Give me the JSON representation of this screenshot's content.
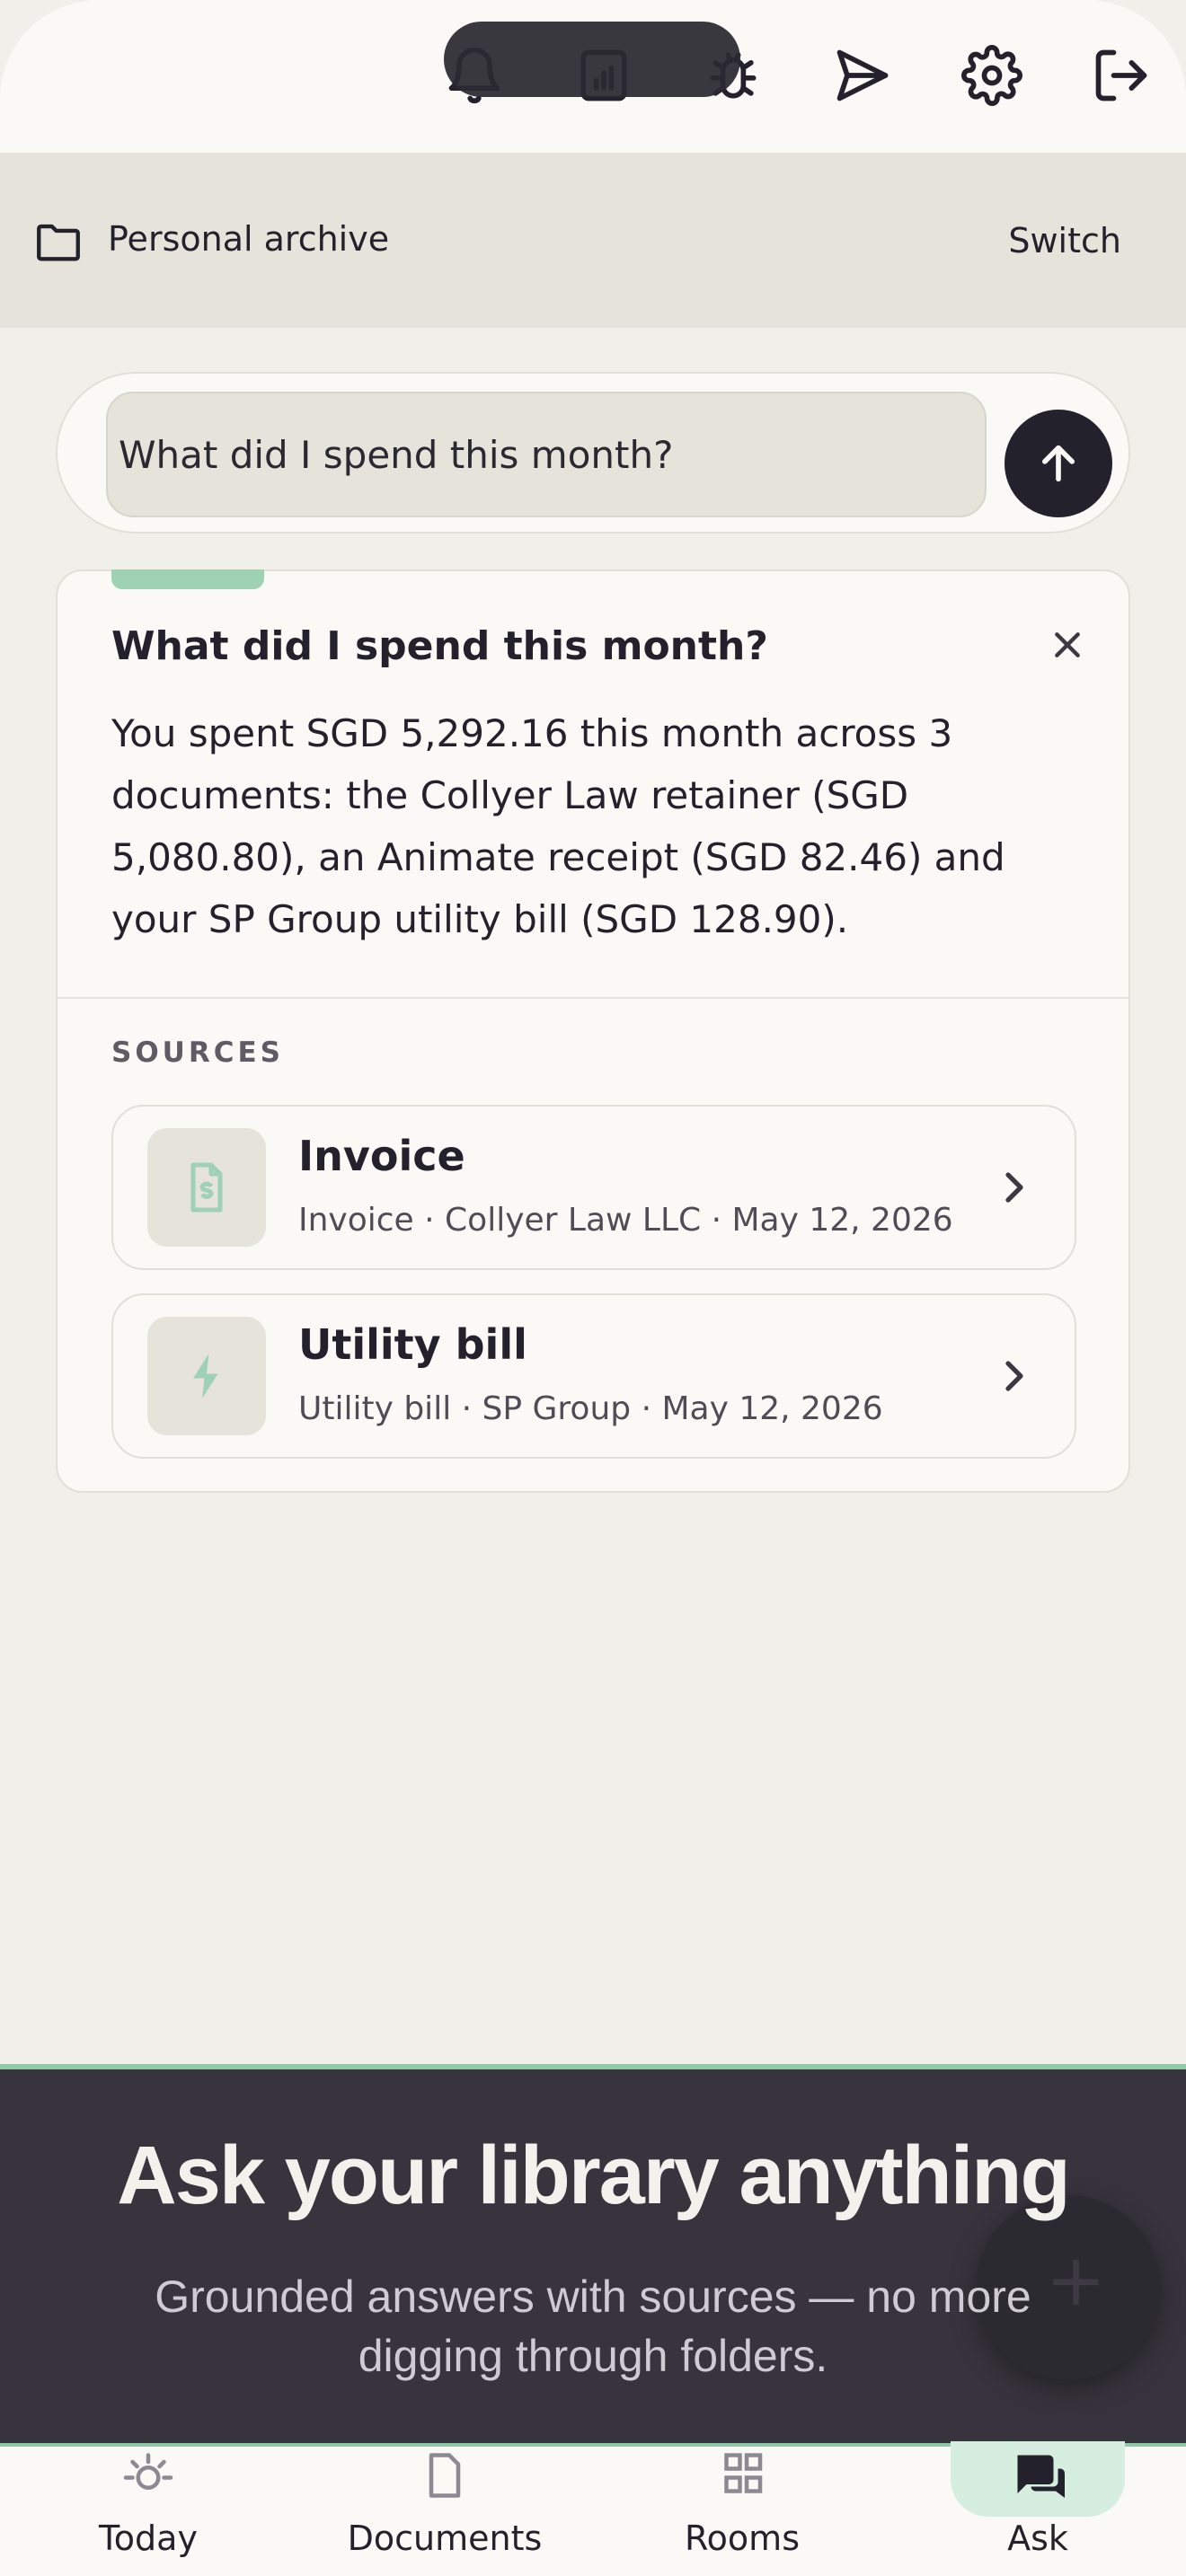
{
  "top_bar": {
    "icons": [
      "bell-icon",
      "report-icon",
      "bug-icon",
      "send-icon",
      "gear-icon",
      "logout-icon"
    ]
  },
  "archive": {
    "name": "Personal archive",
    "switch_label": "Switch"
  },
  "ask": {
    "query": "What did I spend this month?"
  },
  "answer": {
    "title": "What did I spend this month?",
    "body": "You spent SGD 5,292.16 this month across 3 documents: the Collyer Law retainer (SGD 5,080.80), an Animate receipt (SGD 82.46) and your SP Group utility bill (SGD 128.90).",
    "sources_label": "SOURCES",
    "sources": [
      {
        "title": "Invoice",
        "meta": "Invoice · Collyer Law LLC · May 12, 2026",
        "icon": "invoice-icon"
      },
      {
        "title": "Utility bill",
        "meta": "Utility bill · SP Group · May 12, 2026",
        "icon": "lightning-icon"
      }
    ]
  },
  "banner": {
    "title": "Ask your library anything",
    "subtitle": "Grounded answers with sources — no more digging through folders."
  },
  "nav": {
    "items": [
      {
        "label": "Today",
        "icon": "sun-icon"
      },
      {
        "label": "Documents",
        "icon": "document-icon"
      },
      {
        "label": "Rooms",
        "icon": "grid-icon"
      },
      {
        "label": "Ask",
        "icon": "chat-icon",
        "active": true
      }
    ]
  },
  "colors": {
    "accent": "#9fd1b4",
    "dark": "#23212b",
    "banner": "#37343d",
    "background": "#f1efe9"
  }
}
